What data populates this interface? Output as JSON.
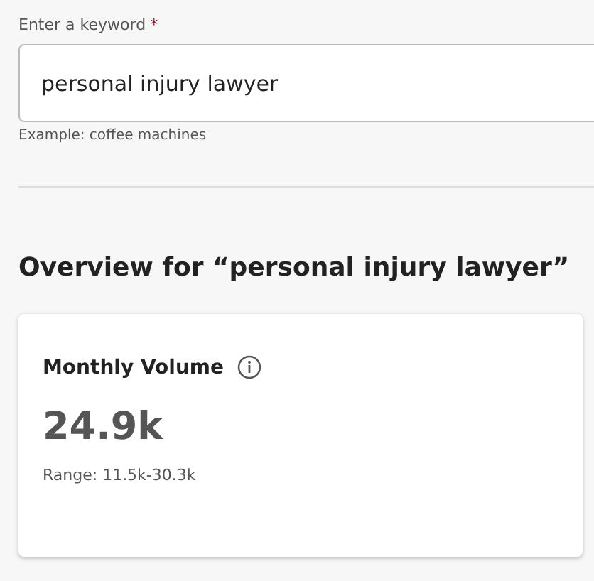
{
  "keyword_field": {
    "label": "Enter a keyword",
    "required_mark": "*",
    "value": "personal injury lawyer",
    "hint": "Example: coffee machines"
  },
  "overview": {
    "heading": "Overview for “personal injury lawyer”",
    "card": {
      "title": "Monthly Volume",
      "value": "24.9k",
      "range": "Range: 11.5k-30.3k"
    }
  }
}
